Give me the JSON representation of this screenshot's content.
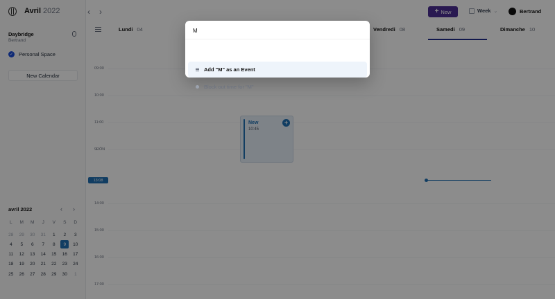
{
  "header": {
    "month": "Avril",
    "year": "2022",
    "new_button": "New",
    "view": "Week",
    "user": "Bertrand"
  },
  "sidebar": {
    "space_name": "Daybridge",
    "space_user": "Bertrand",
    "calendars": [
      {
        "label": "Personal Space",
        "checked": true
      }
    ],
    "new_calendar": "New Calendar"
  },
  "mini_calendar": {
    "title": "avril 2022",
    "weekdays": [
      "L",
      "M",
      "M",
      "J",
      "V",
      "S",
      "D"
    ],
    "days": [
      [
        "28",
        "29",
        "30",
        "31",
        "1",
        "2",
        "3"
      ],
      [
        "4",
        "5",
        "6",
        "7",
        "8",
        "9",
        "10"
      ],
      [
        "11",
        "12",
        "13",
        "14",
        "15",
        "16",
        "17"
      ],
      [
        "18",
        "19",
        "20",
        "21",
        "22",
        "23",
        "24"
      ],
      [
        "25",
        "26",
        "27",
        "28",
        "29",
        "30",
        "1"
      ]
    ],
    "today": "9"
  },
  "week": {
    "days": [
      {
        "name": "Lundi",
        "num": "04"
      },
      {
        "name": "Vendredi",
        "num": "08"
      },
      {
        "name": "Samedi",
        "num": "09"
      },
      {
        "name": "Dimanche",
        "num": "10"
      }
    ],
    "times": [
      "09:00",
      "10:00",
      "11:00",
      "9ÐÖN",
      "14:00",
      "15:00",
      "16:00",
      "17:00"
    ],
    "now_label": "13:08"
  },
  "event": {
    "title": "New",
    "time": "10:45"
  },
  "palette": {
    "query": "M",
    "items": [
      {
        "label": "Add \"M\" as an Event",
        "icon": "list-icon",
        "active": true
      },
      {
        "label": "Block out time for \"M\"",
        "icon": "dot-icon",
        "active": false
      }
    ]
  }
}
